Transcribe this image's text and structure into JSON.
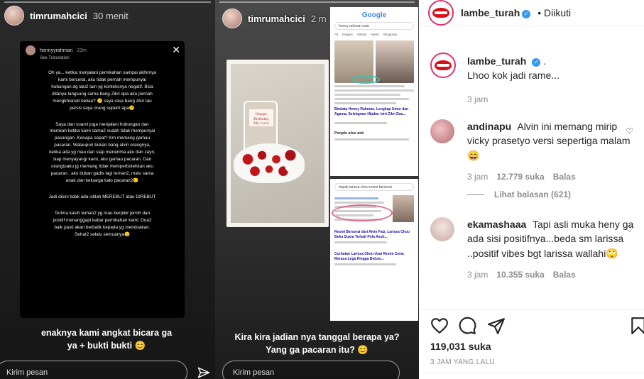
{
  "story1": {
    "username": "timrumahcici",
    "time": "30 menit",
    "notes": {
      "username": "hennyyrahman",
      "time": "23m",
      "translate": "See Translation",
      "para1": "Oh ya... ketika menjalani pernikahan sampai akhirnya\nkami bercerai, aku tidak pernah mempunyai\nhubungan dg laki2 lain yg konteksnya negatif. Bisa\nditanya langsung sama bang Zikri apa aku pernah\nmengkhianati beliau? 🙂 saya rasa bang zikri tau\npersis saya orang seperti apa🙂",
      "para2": "Saya dan suami juga menjalani hubungan dan\nmenikah ketika kami sama2 sudah tidak mempunyai\npasangan. Kenapa cepat? Krn memang gamau\npacaran. Walaupun bukan bang alvin orangnya,\nketika ada yg mau dan siap menerima aku dan zayn,\nsiap menyayangi kami, aku gamau pacaran. Dan\norangtuaku jg memang tidak memperbolehkan aku\npacaran.. aku bukan gadis lagi teman2, malu sama\nanak dan keluarga kalo pacaran2🙂",
      "para3": "Jadi disini tidak ada istilah MEREBUT atau DIREBUT",
      "para4": "Terima kasih teman2 yg mau berpikir jernih dan\npositif menanggapi kabar pernikahan kami. Doa2\nbaik pasti akan berbalik kepada yg mendoakan.\nSehat2 selalu semuanya🙂"
    },
    "caption": "enaknya kami angkat bicara ga\nya + bukti bukti 😊",
    "reply_placeholder": "Kirim pesan"
  },
  "story2": {
    "username": "timrumahcici",
    "time": "2 m",
    "caption": "Kira kira jadian nya tanggal berapa ya?\nYang ga pacaran itu? 😊",
    "reply_placeholder": "Kirim pesan",
    "card_text": "Happy Birthday\nMy Love",
    "google": {
      "logo": "Google",
      "query": "henny rahman usia",
      "tabs": [
        "All",
        "Images",
        "Videos",
        "News",
        "Shopping"
      ],
      "result_title": "Biodata Henny Rahman, Lengkap Umur dan Agama, Selebgram Hijaber Istri Zikri Dau...",
      "people_ask": "People also ask"
    },
    "bing": {
      "query": "bapak larissa chou resmi bercerai",
      "result_title": "Resmi Bercerai dari Alvin Faiz, Larissa Chou Buka Suara Terkait Pola Asuh...",
      "result_title2": "Curhatan Larissa Chou Usai Resmi Cerai, Merasa Lega Hingga Belum..."
    }
  },
  "post": {
    "username": "lambe_turah",
    "follow_status": "Diikuti",
    "caption_user": "lambe_turah",
    "caption_text": ".",
    "caption_line2": "Lhoo kok jadi rame...",
    "caption_time": "3 jam",
    "comments": [
      {
        "user": "andinapu",
        "text": "Alvin ini memang mirip vicky prasetyo versi sepertiga malam 😄",
        "time": "3 jam",
        "likes": "12.779 suka",
        "reply": "Balas"
      },
      {
        "user": "ekamashaaa",
        "text": "Tapi asli muka heny ga ada sisi positifnya...beda sm larissa ..positif vibes bgt larissa wallahi🙄",
        "time": "3 jam",
        "likes": "10.355 suka",
        "reply": "Balas"
      }
    ],
    "view_replies": "Lihat balasan (621)",
    "likes_count": "119,031 suka",
    "timestamp": "3 JAM YANG LALU"
  }
}
